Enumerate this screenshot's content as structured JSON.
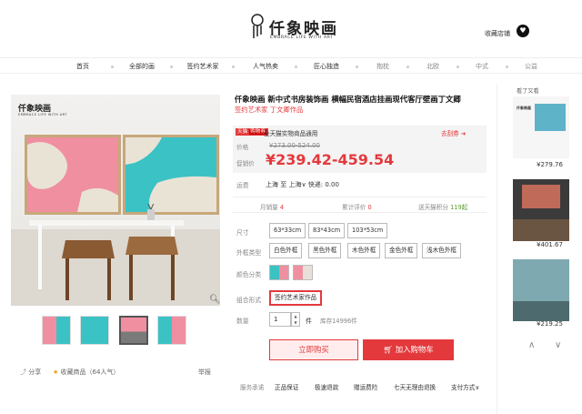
{
  "header": {
    "logo_cn": "仟象映画",
    "logo_en": "EMBRACE LIFE WITH ART",
    "favorite_store": "收藏店铺"
  },
  "nav": {
    "items": [
      "首页",
      "全部的画",
      "签约艺术家",
      "人气热卖",
      "匠心独造"
    ],
    "gray_items": [
      "抱枕",
      "北欧",
      "中式",
      "公益"
    ]
  },
  "gallery": {
    "image_logo_cn": "仟象映画",
    "image_logo_en": "EMBRACE LIFE WITH ART"
  },
  "actions": {
    "share": "分享",
    "collect": "收藏商品（64人气）",
    "report": "举报"
  },
  "product": {
    "title": "仟象映画 新中式书房装饰画 横幅民宿酒店挂画现代客厅壁画丁文卿",
    "subtitle": "签约艺术家 丁文卿作品",
    "tmall_badge": "天猫",
    "tmall_badge2": "购物券",
    "tmall_text": "全天猫实物商品通用",
    "explore": "去刮券",
    "price_label": "价格",
    "orig_price": "¥273.00-524.00",
    "promo_label": "促销价",
    "promo_price": "¥239.42-459.54",
    "ship_label": "运费",
    "ship_text": "上海 至 上海∨ 快递: 0.00"
  },
  "stats": {
    "monthly_label": "月销量",
    "monthly_value": "4",
    "reviews_label": "累计评价",
    "reviews_value": "0",
    "points_label": "送天猫积分",
    "points_value": "119起"
  },
  "options": {
    "size_label": "尺寸",
    "sizes": [
      "63*33cm",
      "83*43cm",
      "103*53cm"
    ],
    "frame_label": "外框类型",
    "frames": [
      "白色外框",
      "黑色外框",
      "木色外框",
      "金色外框",
      "浅木色外框"
    ],
    "color_label": "颜色分类",
    "combo_label": "组合形式",
    "combo_selected": "签约艺术家作品",
    "qty_label": "数量",
    "qty_value": "1",
    "qty_unit": "件",
    "stock": "库存14996件"
  },
  "buttons": {
    "buy_now": "立即购买",
    "add_cart": "加入购物车"
  },
  "commitments": {
    "label": "服务承诺",
    "items": [
      "正品保证",
      "极速退款",
      "赠运费险",
      "七天无理由退换"
    ],
    "payment": "支付方式∨"
  },
  "sidebar": {
    "title": "看了又看",
    "prices": [
      "¥279.76",
      "¥401.67",
      "¥219.25"
    ]
  },
  "colors": {
    "accent": "#e4393c",
    "pink": "#f08fa0",
    "teal": "#3bc2c4"
  }
}
